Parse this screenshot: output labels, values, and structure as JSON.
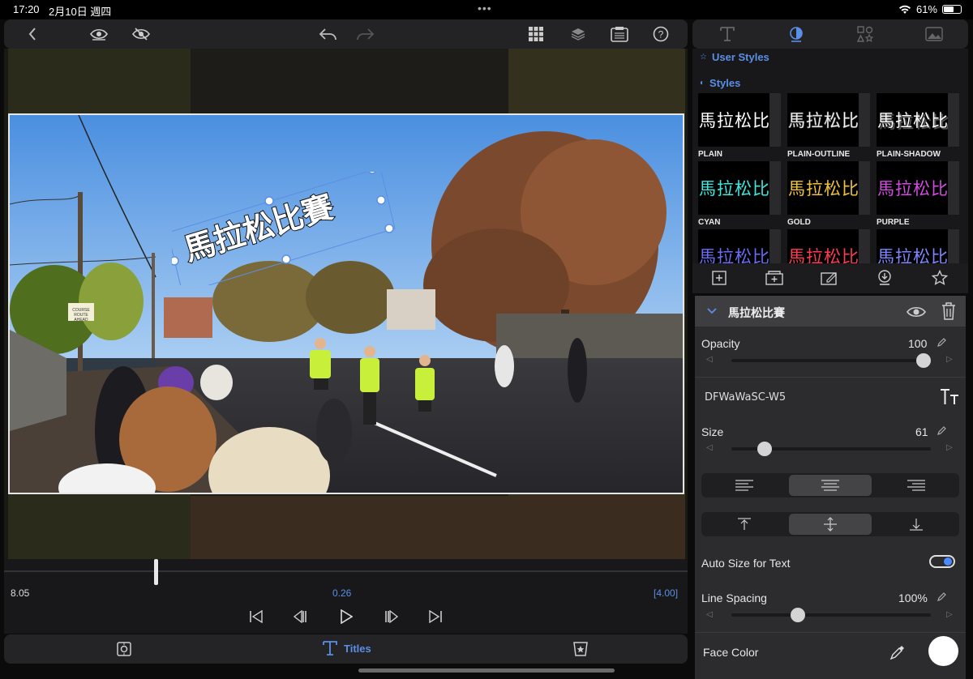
{
  "status": {
    "time": "17:20",
    "date": "2月10日 週四",
    "battery": "61%",
    "battery_level": 0.61
  },
  "toolbar": {
    "back": "back-icon",
    "eye": "eye-icon",
    "eye_off": "eye-off-icon",
    "undo": "undo-icon",
    "redo": "redo-icon",
    "grid": "grid-icon",
    "layers": "layers-icon",
    "clipboard": "clipboard-icon",
    "help": "?"
  },
  "preview": {
    "title_text": "馬拉松比賽",
    "sign_text": [
      "COURSE",
      "ROUTE",
      "AHEAD"
    ]
  },
  "timeline": {
    "start": "8.05",
    "current": "0.26",
    "end": "[4.00]",
    "playhead_position": 0.22
  },
  "bottombar": {
    "left_icon": "crop-icon",
    "center_label": "Titles",
    "right_icon": "effects-icon"
  },
  "right_tabs": [
    "text-icon",
    "style-icon",
    "shapes-icon",
    "image-icon"
  ],
  "styles": {
    "user_styles_label": "User Styles",
    "styles_label": "Styles",
    "items": [
      {
        "label": "PLAIN",
        "sample": "馬拉松比",
        "color": "#ffffff"
      },
      {
        "label": "PLAIN-OUTLINE",
        "sample": "馬拉松比",
        "color": "#ffffff"
      },
      {
        "label": "PLAIN-SHADOW",
        "sample": "馬拉松比",
        "color": "#ffffff"
      },
      {
        "label": "CYAN",
        "sample": "馬拉松比",
        "color": "#3ee6dc"
      },
      {
        "label": "GOLD",
        "sample": "馬拉松比",
        "color": "#f0c23a"
      },
      {
        "label": "PURPLE",
        "sample": "馬拉松比",
        "color": "#d24ae0"
      },
      {
        "label": "",
        "sample": "馬拉松比",
        "color": "#6a6cf5"
      },
      {
        "label": "",
        "sample": "馬拉松比",
        "color": "#ff3a52"
      },
      {
        "label": "",
        "sample": "馬拉松比",
        "color": "#7d86ff"
      }
    ]
  },
  "props": {
    "title_name": "馬拉松比賽",
    "opacity_label": "Opacity",
    "opacity_value": "100",
    "opacity_level": 1.0,
    "font_name": "DFWaWaSC-W5",
    "size_label": "Size",
    "size_value": "61",
    "size_level": 0.14,
    "auto_size_label": "Auto Size for Text",
    "auto_size_on": true,
    "line_spacing_label": "Line Spacing",
    "line_spacing_value": "100%",
    "line_spacing_level": 0.32,
    "face_color_label": "Face Color",
    "accent": "#5b8ee6"
  }
}
